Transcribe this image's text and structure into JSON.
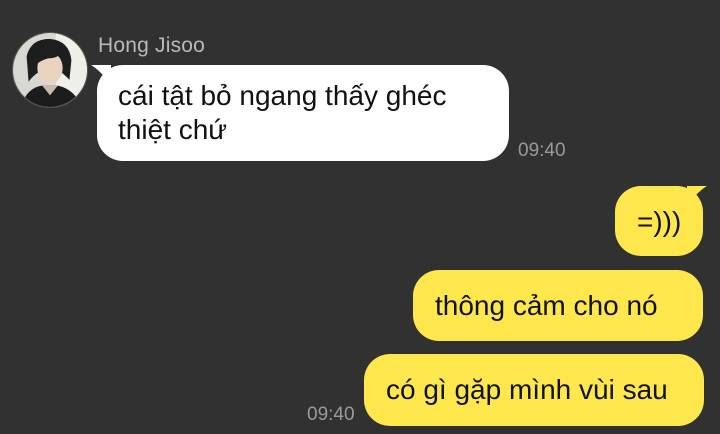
{
  "chat": {
    "contact": {
      "name": "Hong Jisoo",
      "avatar_icon": "profile-photo"
    },
    "incoming": [
      {
        "text": "cái tật bỏ ngang thấy ghéc thiệt chứ",
        "time": "09:40"
      }
    ],
    "outgoing": [
      {
        "text": "=)))"
      },
      {
        "text": "thông cảm cho nó"
      },
      {
        "text": "có gì gặp mình vùi sau"
      }
    ],
    "outgoing_time": "09:40"
  },
  "colors": {
    "background": "#313131",
    "incoming_bubble": "#ffffff",
    "outgoing_bubble": "#fde74c",
    "sender_name": "#b9b9b9",
    "timestamp": "#9a9a9a"
  }
}
